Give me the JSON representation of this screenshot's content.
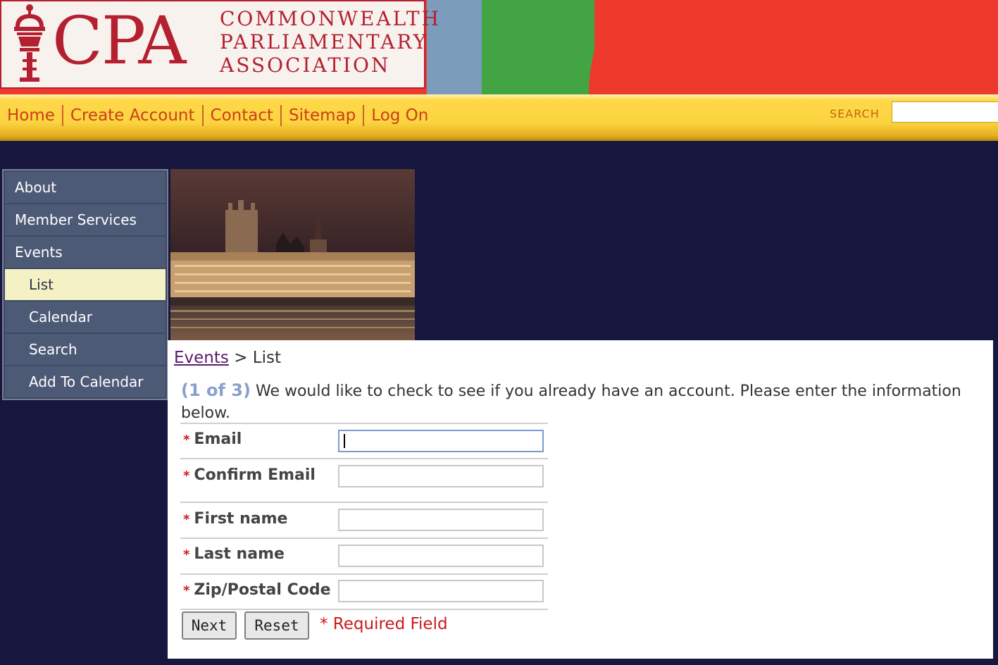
{
  "logo": {
    "abbr": "CPA",
    "name_lines": [
      "COMMONWEALTH",
      "PARLIAMENTARY",
      "ASSOCIATION"
    ],
    "brand_color": "#b52030"
  },
  "nav": {
    "links": [
      "Home",
      "Create Account",
      "Contact",
      "Sitemap",
      "Log On"
    ],
    "search_label": "SEARCH",
    "search_value": ""
  },
  "sidebar": {
    "items": [
      {
        "label": "About"
      },
      {
        "label": "Member Services"
      },
      {
        "label": "Events"
      },
      {
        "label": "List",
        "active": true
      },
      {
        "label": "Calendar"
      },
      {
        "label": "Search"
      },
      {
        "label": "Add To Calendar"
      }
    ]
  },
  "breadcrumb": {
    "parent": "Events",
    "separator": ">",
    "current": "List"
  },
  "intro": {
    "step": "(1 of 3)",
    "text": "We would like to check to see if you already have an account. Please enter the information below."
  },
  "form": {
    "required_marker": "*",
    "fields": [
      {
        "label": "Email",
        "value": ""
      },
      {
        "label": "Confirm Email",
        "value": ""
      },
      {
        "label": "First name",
        "value": ""
      },
      {
        "label": "Last name",
        "value": ""
      },
      {
        "label": "Zip/Postal Code",
        "value": ""
      }
    ],
    "next_label": "Next",
    "reset_label": "Reset",
    "required_note": "* Required Field"
  },
  "colors": {
    "page_background": "#16163f",
    "nav_text": "#c8401a",
    "sidebar_active": "#f4f2c4",
    "required": "#cc1a1a"
  }
}
